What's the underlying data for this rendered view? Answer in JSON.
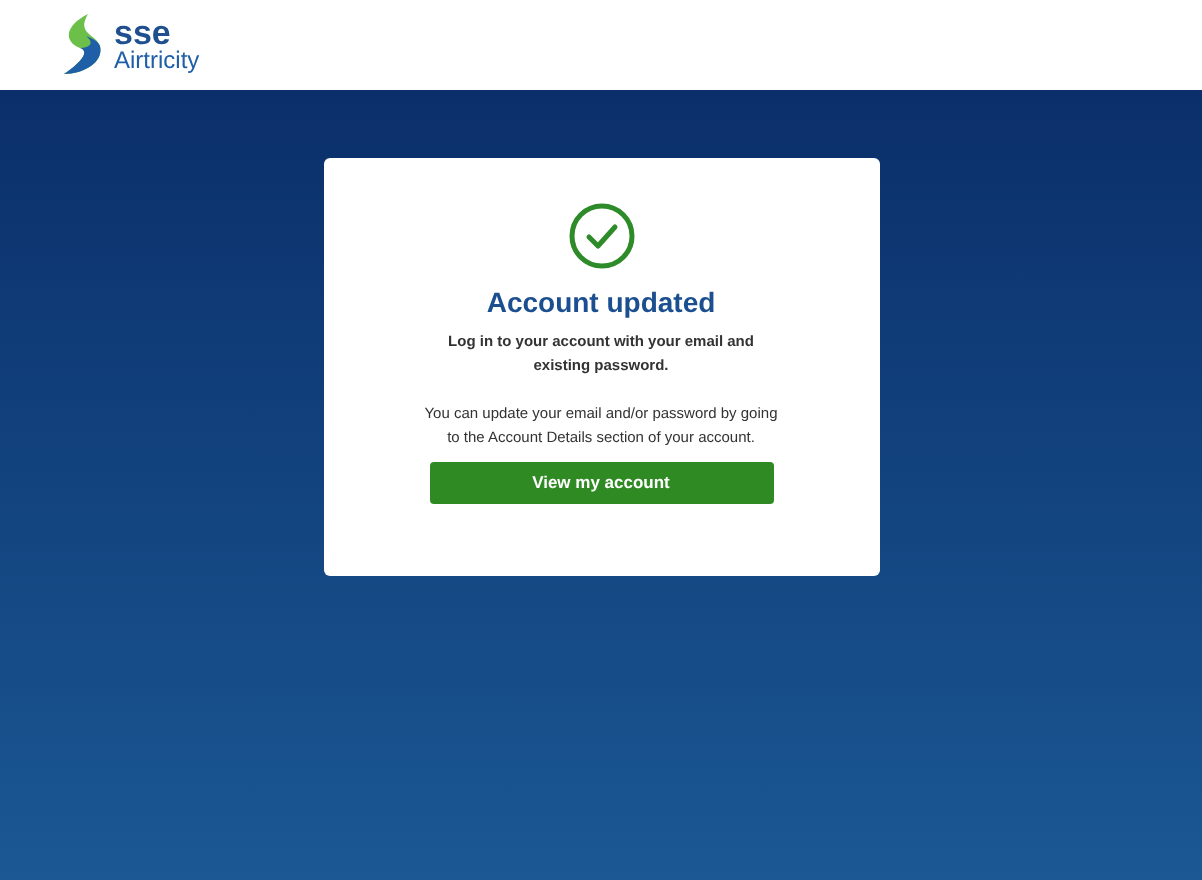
{
  "header": {
    "logo": {
      "line_1": "sse",
      "line_2": "Airtricity"
    }
  },
  "card": {
    "title": "Account updated",
    "paragraphs": [
      "Log in to your account with your email and existing password.",
      "You can update your email and/or password by going to the Account Details section of your account."
    ],
    "button": "View my account"
  }
}
